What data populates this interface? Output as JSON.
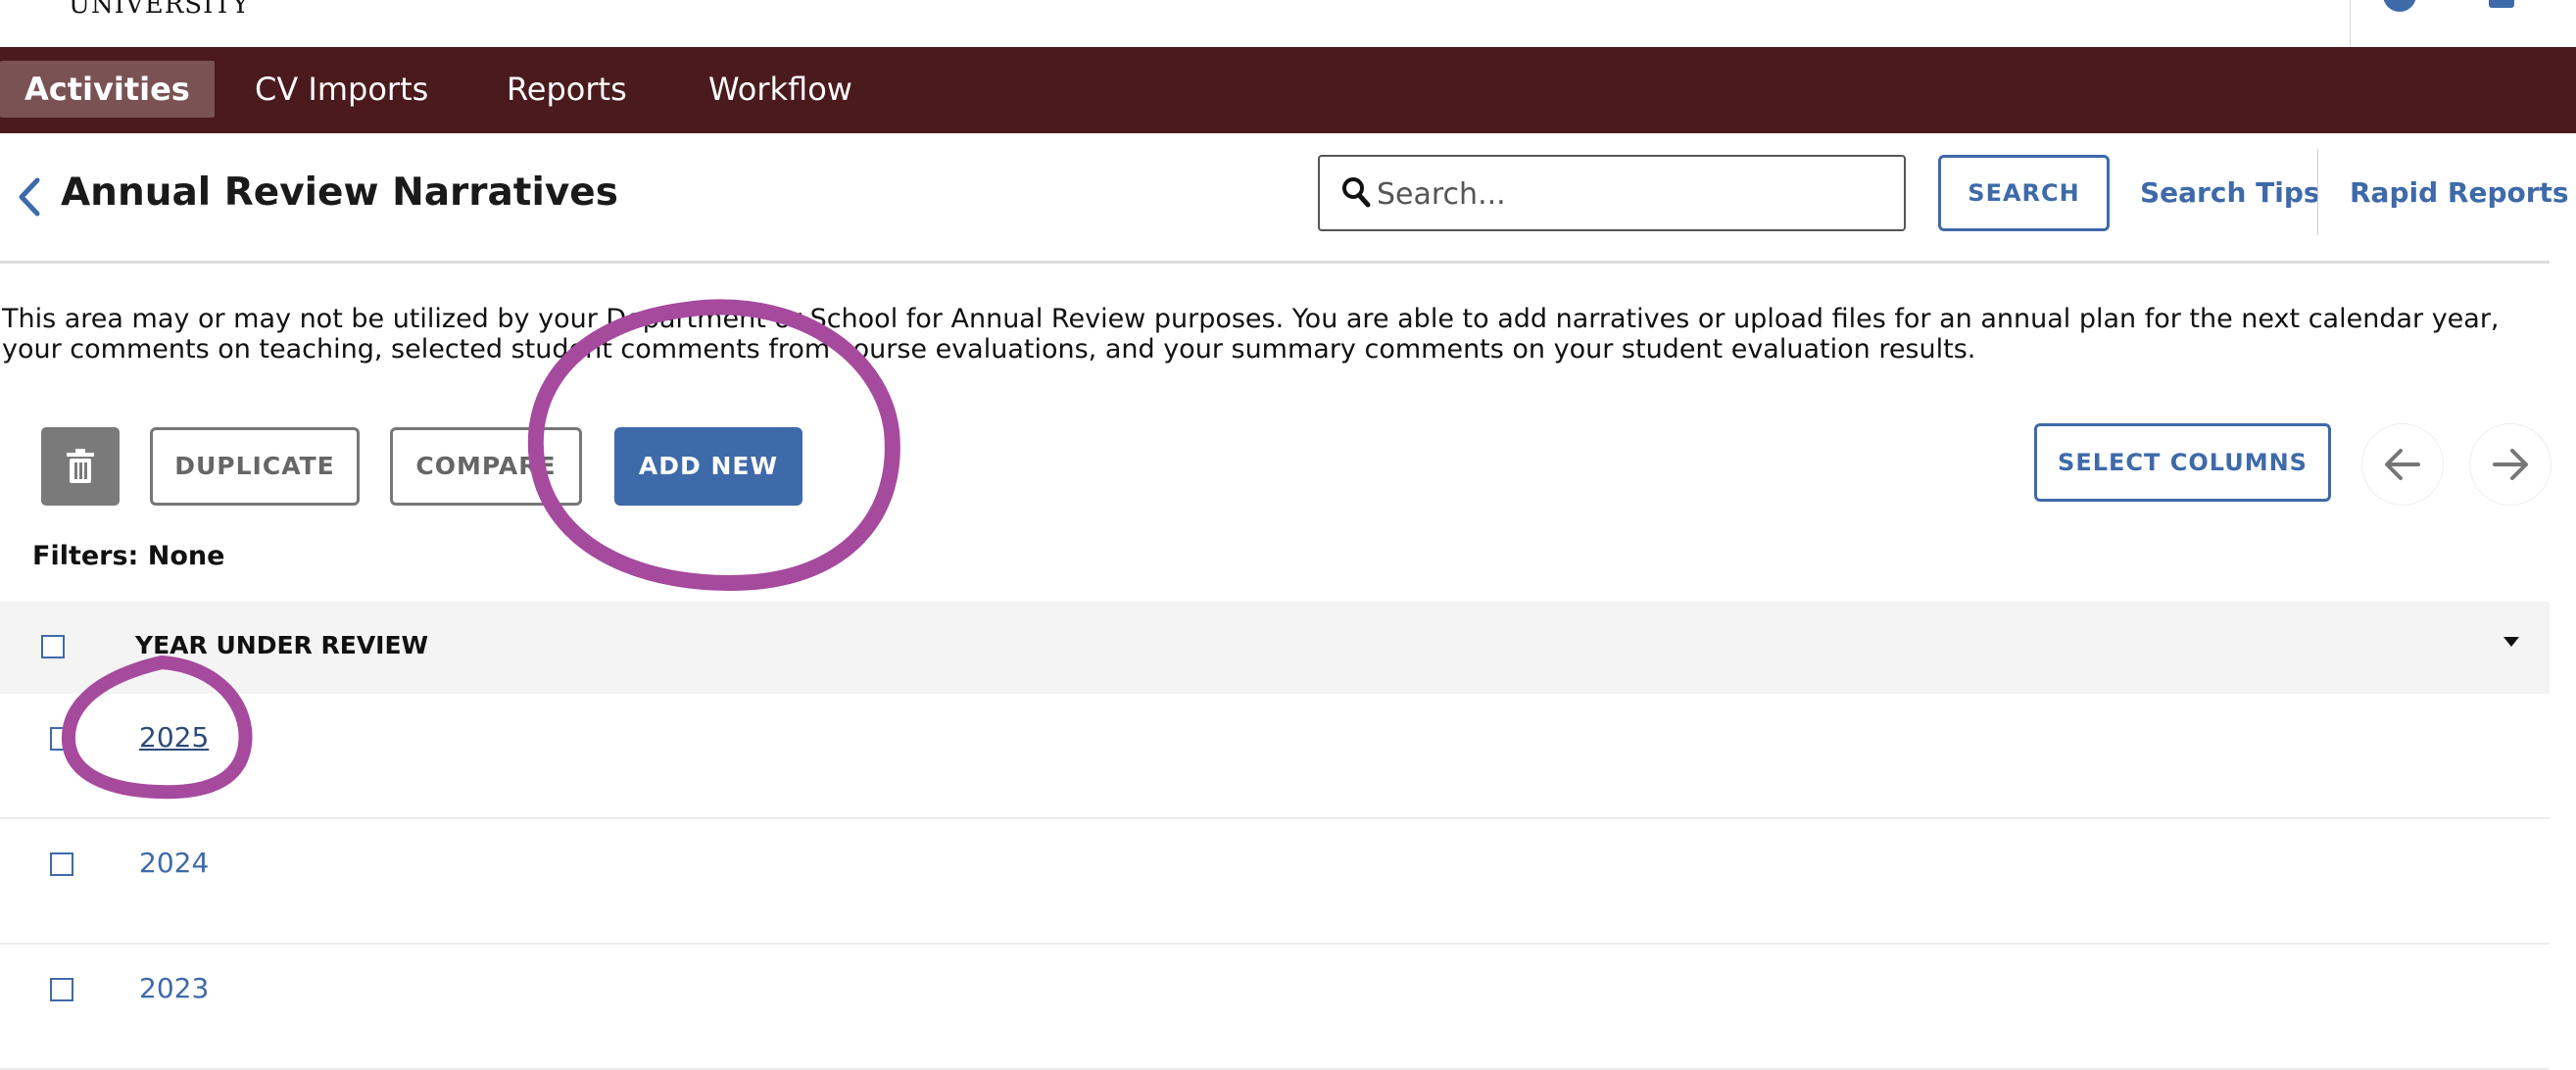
{
  "header": {
    "logo_text": "UNIVERSITY",
    "help_icon": "help-circle-icon",
    "user_icon": "user-icon"
  },
  "nav": {
    "items": [
      {
        "label": "Activities",
        "active": true
      },
      {
        "label": "CV Imports",
        "active": false
      },
      {
        "label": "Reports",
        "active": false
      },
      {
        "label": "Workflow",
        "active": false
      }
    ]
  },
  "page": {
    "title": "Annual Review Narratives",
    "back_icon": "chevron-left-icon",
    "search_placeholder": "Search...",
    "search_value": "",
    "search_button": "SEARCH",
    "search_tips": "Search Tips",
    "rapid_reports": "Rapid Reports",
    "description": "This area may or may not be utilized by your Department or School for Annual Review purposes. You are able to add narratives or upload files for an annual plan for the next calendar year, your comments on teaching, selected student comments from course evaluations, and your summary comments on your student evaluation results."
  },
  "toolbar": {
    "delete_icon": "trash-icon",
    "duplicate": "DUPLICATE",
    "compare": "COMPARE",
    "add_new": "ADD NEW",
    "select_columns": "SELECT COLUMNS",
    "prev_icon": "arrow-left-icon",
    "next_icon": "arrow-right-icon"
  },
  "filters": {
    "label": "Filters: None"
  },
  "table": {
    "column_header": "YEAR UNDER REVIEW",
    "rows": [
      {
        "year": "2025"
      },
      {
        "year": "2024"
      },
      {
        "year": "2023"
      }
    ]
  },
  "colors": {
    "nav_bg": "#4b1a1d",
    "nav_active": "#7a5254",
    "accent": "#3e6aaa",
    "annotation": "#a64a9e"
  }
}
